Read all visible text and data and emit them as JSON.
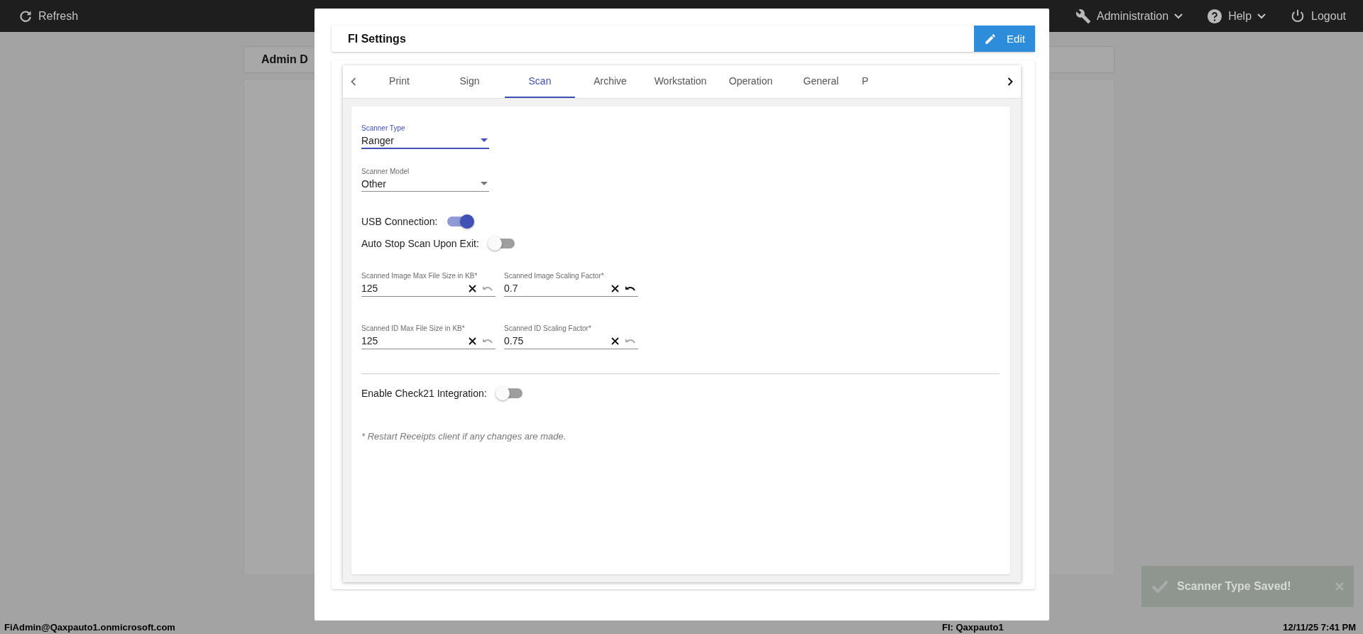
{
  "topbar": {
    "refresh": "Refresh",
    "menus": [
      {
        "label": "Administration",
        "kind": "wrench",
        "dropdown": true
      },
      {
        "label": "Help",
        "kind": "help",
        "dropdown": true
      },
      {
        "label": "Logout",
        "kind": "power",
        "dropdown": false
      }
    ]
  },
  "background": {
    "card_title": "Admin D"
  },
  "modal": {
    "title": "FI Settings",
    "edit_button": "Edit",
    "tabs": [
      {
        "label": "Print",
        "selected": false
      },
      {
        "label": "Sign",
        "selected": false
      },
      {
        "label": "Scan",
        "selected": true
      },
      {
        "label": "Archive",
        "selected": false
      },
      {
        "label": "Workstation",
        "selected": false
      },
      {
        "label": "Operation",
        "selected": false
      },
      {
        "label": "General",
        "selected": false
      },
      {
        "label": "P",
        "selected": false
      }
    ],
    "form": {
      "selects": [
        {
          "label": "Scanner Type",
          "value": "Ranger",
          "focused": true
        },
        {
          "label": "Scanner Model",
          "value": "Other",
          "focused": false
        }
      ],
      "switches": [
        {
          "label": "USB Connection:",
          "on": true
        },
        {
          "label": "Auto Stop Scan Upon Exit:",
          "on": false
        }
      ],
      "field_rows": [
        [
          {
            "label": "Scanned Image Max File Size in KB*",
            "value": "125",
            "undo_enabled": false
          },
          {
            "label": "Scanned Image Scaling Factor*",
            "value": "0.7",
            "undo_enabled": true
          }
        ],
        [
          {
            "label": "Scanned ID Max File Size in KB*",
            "value": "125",
            "undo_enabled": false
          },
          {
            "label": "Scanned ID Scaling Factor*",
            "value": "0.75",
            "undo_enabled": false
          }
        ]
      ],
      "check21": {
        "label": "Enable Check21 Integration:",
        "on": false
      },
      "note": "* Restart Receipts client if any changes are made."
    }
  },
  "toast": {
    "message": "Scanner Type Saved!"
  },
  "footer": {
    "user": "FiAdmin@Qaxpauto1.onmicrosoft.com",
    "fi": "FI: Qaxpauto1",
    "datetime": "12/11/25 7:41 PM"
  }
}
